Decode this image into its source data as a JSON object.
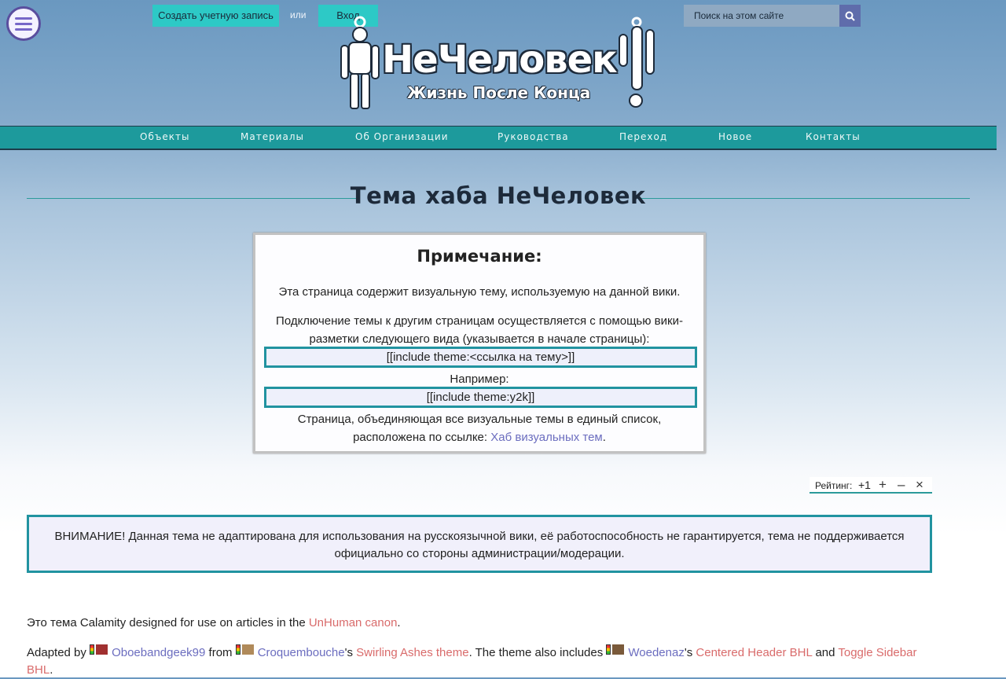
{
  "header": {
    "create_account": "Создать учетную запись",
    "or": "или",
    "login": "Вход",
    "search_placeholder": "Поиск на этом сайте",
    "logo_title": "НеЧеловек",
    "logo_subtitle": "Жизнь После Конца"
  },
  "nav": {
    "items": [
      "Объекты",
      "Материалы",
      "Об Организации",
      "Руководства",
      "Переход",
      "Новое",
      "Контакты"
    ]
  },
  "page": {
    "title": "Тема хаба НеЧеловек"
  },
  "note": {
    "heading": "Примечание:",
    "p1": "Эта страница содержит визуальную тему, используемую на данной вики.",
    "p2": "Подключение темы к другим страницам осуществляется с помощью вики-разметки следующего вида (указывается в начале страницы):",
    "code1": "[[include theme:<ссылка на тему>]]",
    "example_label": "Например:",
    "code2": "[[include theme:y2k]]",
    "p3_line1": "Страница, объединяющая все визуальные темы в единый список,",
    "p3_prefix": "расположена по ссылке: ",
    "p3_link": "Хаб визуальных тем",
    "p3_suffix": "."
  },
  "rating": {
    "label": "Рейтинг:",
    "value": "+1",
    "plus": "+",
    "minus": "–",
    "close": "×"
  },
  "warning": {
    "text": "ВНИМАНИЕ! Данная тема не адаптирована для использования на русскоязычной вики, её работоспособность не гарантируется, тема не поддерживается официально со стороны администрации/модерации."
  },
  "content": {
    "line1_prefix": "Это тема Calamity designed for use on articles in the ",
    "line1_link": "UnHuman canon",
    "line1_suffix": ".",
    "adapted_by": "Adapted by",
    "user1": "Oboebandgeek99",
    "from": "from",
    "user2": "Croquembouche",
    "possessive": "'s",
    "theme_link": "Swirling Ashes theme",
    "also_includes": ". The theme also includes",
    "user3": "Woedenaz",
    "possessive2": "'s",
    "centered_header": "Centered Header BHL",
    "and": "and",
    "toggle_sidebar": "Toggle Sidebar BHL",
    "end": "."
  },
  "colors": {
    "accent_teal": "#1d9a9c",
    "button_cyan": "#2dc9c6",
    "link_red": "#d96b6b",
    "link_purple": "#6b6dbf"
  }
}
